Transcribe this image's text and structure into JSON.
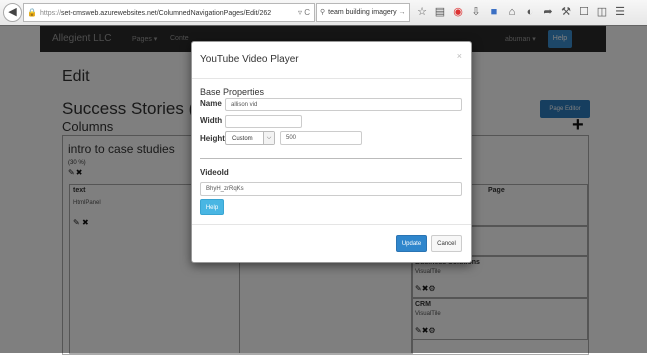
{
  "browser": {
    "url_scheme": "https://",
    "url_rest": "set-cmsweb.azurewebsites.net/ColumnedNavigationPages/Edit/262",
    "url_tail": "▿ C",
    "search_value": "team building imagery",
    "icons": [
      "star-icon",
      "clipboard-icon",
      "pocket-icon",
      "download-icon",
      "extension-icon",
      "home-icon",
      "chat-icon",
      "share-icon",
      "tools-icon",
      "window-icon",
      "reader-icon",
      "menu-icon"
    ]
  },
  "app_nav": {
    "brand": "Allegient LLC",
    "pages_menu": "Pages ▾",
    "center_menu": "Conte",
    "user_menu": "abuman ▾",
    "help": "Help"
  },
  "page": {
    "edit_title": "Edit",
    "heading": "Success Stories (Cas",
    "columns_label": "Columns",
    "page_editor_button": "Page Editor",
    "column": {
      "title": "intro to case studies",
      "width_pct": "(30 %)",
      "text_panel": {
        "title": "text",
        "type": "HtmlPanel"
      }
    },
    "right_panels": [
      {
        "peek": "Page"
      },
      {
        "title": "Business Solutions",
        "type": "VisualTile"
      },
      {
        "title": "CRM",
        "type": "VisualTile"
      }
    ]
  },
  "modal": {
    "title": "YouTube Video Player",
    "close": "×",
    "section_title": "Base Properties",
    "name_label": "Name",
    "name_value": "allison vid",
    "width_label": "Width",
    "width_value": "",
    "height_label": "Height",
    "height_mode": "Custom",
    "height_value": "500",
    "video_id_label": "VideoId",
    "video_id_value": "BhyH_zrRqKs",
    "help_button": "Help",
    "update_button": "Update",
    "cancel_button": "Cancel"
  }
}
